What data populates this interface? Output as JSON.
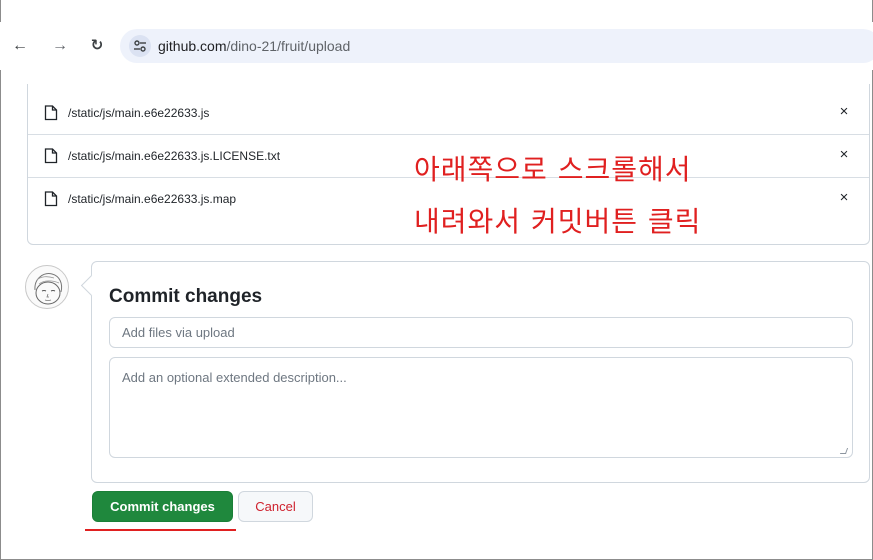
{
  "browser": {
    "back_icon": "arrow-left-icon",
    "forward_icon": "arrow-right-icon",
    "reload_icon": "reload-icon",
    "site_info_icon": "tune-icon",
    "url_host": "github.com",
    "url_path": "/dino-21/fruit/upload"
  },
  "files": [
    {
      "name": "/static/js/main.e6e22633.js",
      "remove": "×"
    },
    {
      "name": "/static/js/main.e6e22633.js.LICENSE.txt",
      "remove": "×"
    },
    {
      "name": "/static/js/main.e6e22633.js.map",
      "remove": "×"
    }
  ],
  "annotation": {
    "line1": "아래쪽으로 스크롤해서",
    "line2": "내려와서 커밋버튼 클릭",
    "color": "#e02020"
  },
  "commit": {
    "title": "Commit changes",
    "summary_placeholder": "Add files via upload",
    "description_placeholder": "Add an optional extended description...",
    "commit_button": "Commit changes",
    "cancel_button": "Cancel"
  },
  "colors": {
    "primary_button": "#1f883d",
    "cancel_text": "#cf222e",
    "border": "#d0d7de"
  }
}
